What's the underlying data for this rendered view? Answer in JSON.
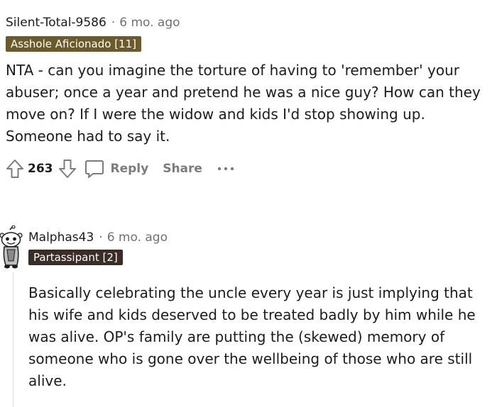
{
  "comments": [
    {
      "author": "Silent-Total-9586",
      "separator": "·",
      "time": "6 mo. ago",
      "flair": "Asshole Aficionado [11]",
      "body": [
        "NTA - can you imagine the torture of having to 'remember' your abuser; once a year and pretend he was a nice guy? How can they move on? If I were the widow and kids I'd stop showing up. Someone had to say it."
      ],
      "votes": "263",
      "reply_label": "Reply",
      "share_label": "Share",
      "more_label": "···"
    },
    {
      "author": "Malphas43",
      "separator": "·",
      "time": "6 mo. ago",
      "flair": "Partassipant [2]",
      "body": [
        "Basically celebrating the uncle every year is just implying that his wife and kids deserved to be treated badly by him while he was alive. OP's family are putting the (skewed) memory of someone who is gone over the wellbeing of those who are still alive."
      ]
    }
  ],
  "icons": {
    "upvote": "upvote-icon",
    "downvote": "downvote-icon",
    "reply": "comment-bubble-icon",
    "avatar": "snoo-avatar-icon"
  },
  "colors": {
    "flair1": "#6b5a2a",
    "flair2": "#3a2d28",
    "meta": "#6f7173",
    "action": "#7c7c7c"
  }
}
